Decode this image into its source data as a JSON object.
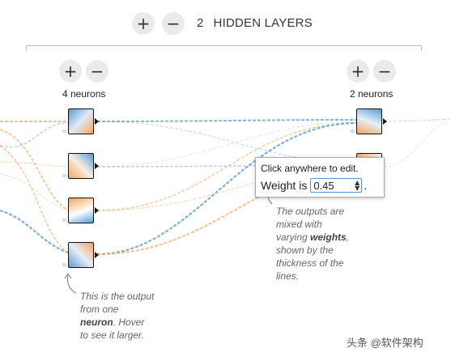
{
  "header": {
    "add_layer_label": "+",
    "remove_layer_label": "−",
    "layer_count": "2",
    "layer_count_suffix": "HIDDEN LAYERS"
  },
  "layers": [
    {
      "add_label": "+",
      "remove_label": "−",
      "neurons_label": "4 neurons",
      "neurons": 4
    },
    {
      "add_label": "+",
      "remove_label": "−",
      "neurons_label": "2 neurons",
      "neurons": 2
    }
  ],
  "tooltip": {
    "line1": "Click anywhere to edit.",
    "weight_prefix": "Weight is",
    "weight_value": "0.45",
    "weight_suffix": "."
  },
  "annotations": {
    "outputs_line1": "The outputs are",
    "outputs_line2": "mixed with",
    "outputs_line3_pre": "varying ",
    "outputs_line3_bold": "weights",
    "outputs_line3_post": ",",
    "outputs_line4": "shown by the",
    "outputs_line5": "thickness of the",
    "outputs_line6": "lines.",
    "neuron_line1": "This is the output",
    "neuron_line2": "from one",
    "neuron_line3_bold": "neuron",
    "neuron_line3_post": ". Hover",
    "neuron_line4": "to see it larger."
  },
  "watermark": "头条 @软件架构",
  "colors": {
    "positive": "#f5a55c",
    "negative": "#5b9bd5",
    "button_bg": "#eaeaea"
  },
  "icons": {
    "add": "plus-icon",
    "remove": "minus-icon",
    "spinner": "spinner-arrows-icon"
  }
}
